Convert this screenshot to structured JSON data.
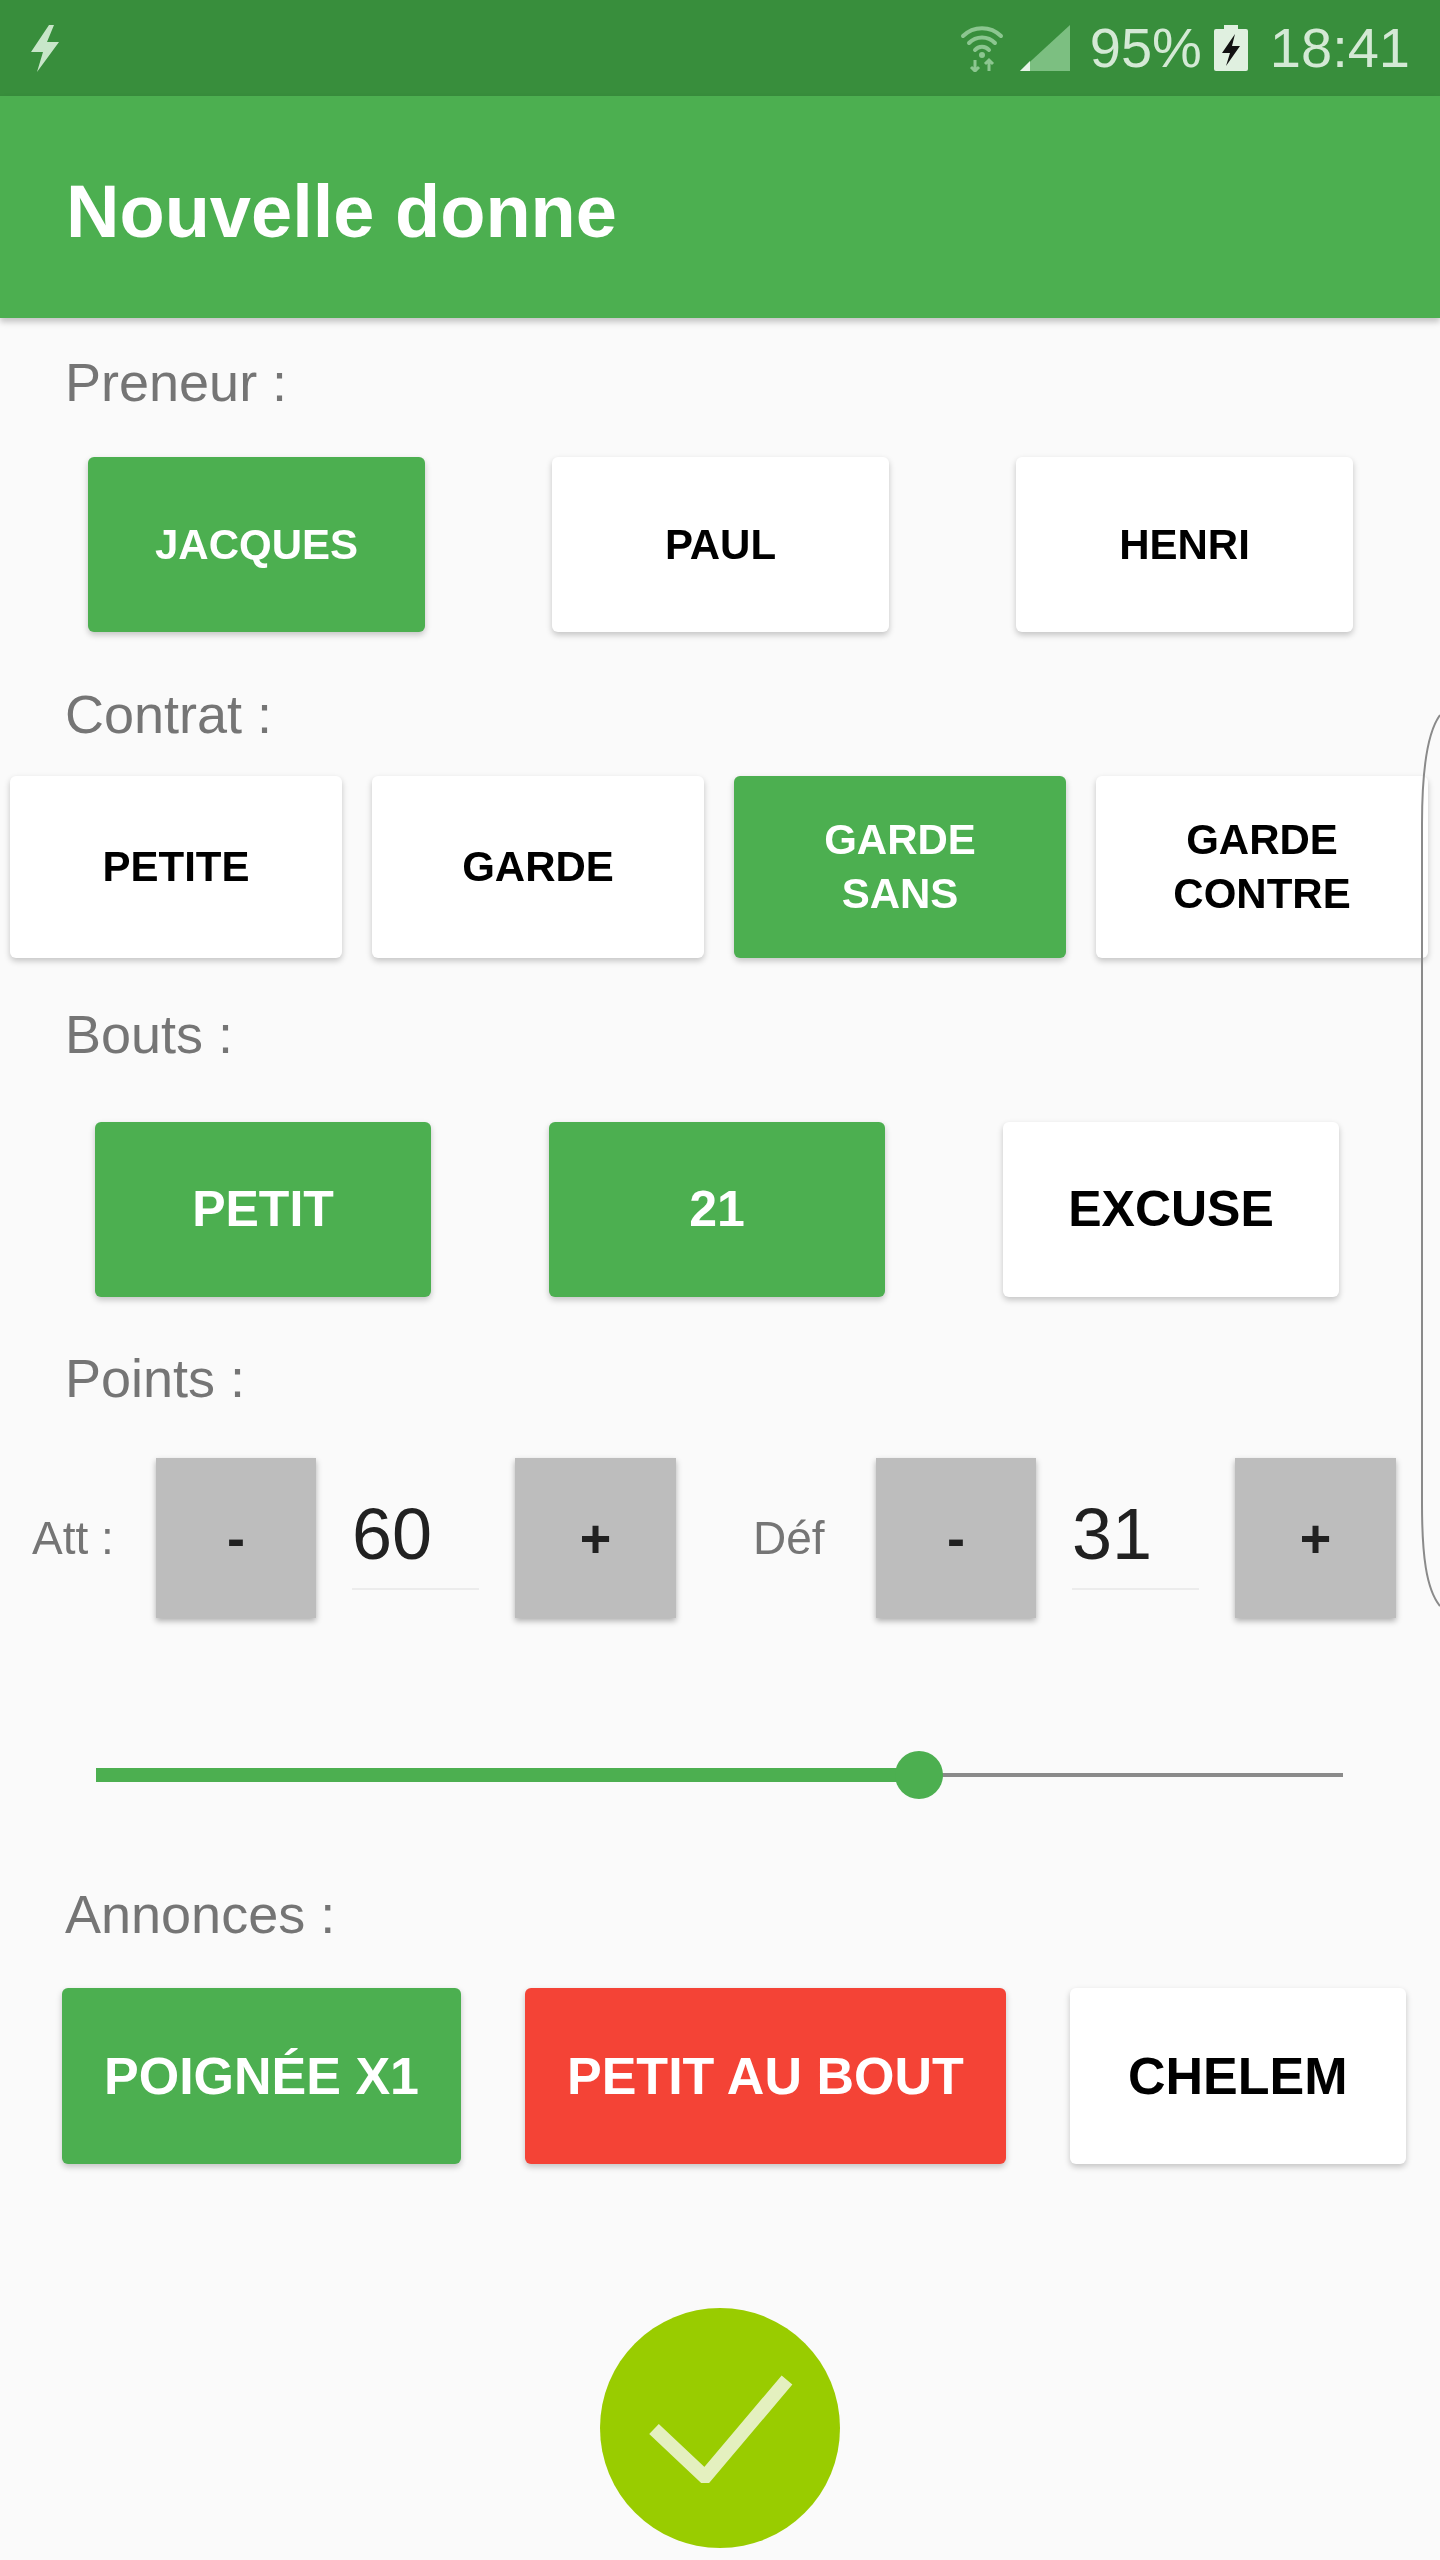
{
  "status_bar": {
    "battery": "95%",
    "time": "18:41"
  },
  "app_bar": {
    "title": "Nouvelle donne"
  },
  "preneur": {
    "label": "Preneur :",
    "options": [
      {
        "label": "JACQUES",
        "selected": true
      },
      {
        "label": "PAUL",
        "selected": false
      },
      {
        "label": "HENRI",
        "selected": false
      }
    ]
  },
  "contrat": {
    "label": "Contrat :",
    "options": [
      {
        "label": "PETITE",
        "selected": false
      },
      {
        "label": "GARDE",
        "selected": false
      },
      {
        "label": "GARDE SANS",
        "selected": true
      },
      {
        "label": "GARDE CONTRE",
        "selected": false
      }
    ]
  },
  "bouts": {
    "label": "Bouts :",
    "options": [
      {
        "label": "PETIT",
        "selected": true
      },
      {
        "label": "21",
        "selected": true
      },
      {
        "label": "EXCUSE",
        "selected": false
      }
    ]
  },
  "points": {
    "label": "Points :",
    "attack": {
      "label": "Att :",
      "decrement": "-",
      "value": "60",
      "increment": "+"
    },
    "defense": {
      "label": "Déf",
      "decrement": "-",
      "value": "31",
      "increment": "+"
    },
    "slider": {
      "level": 0.66
    }
  },
  "annonces": {
    "label": "Annonces :",
    "options": [
      {
        "label": "POIGNÉE X1",
        "selected": true,
        "color": "#4caf50"
      },
      {
        "label": "PETIT AU BOUT",
        "selected": true,
        "color": "#f44336"
      },
      {
        "label": "CHELEM",
        "selected": false
      }
    ]
  }
}
